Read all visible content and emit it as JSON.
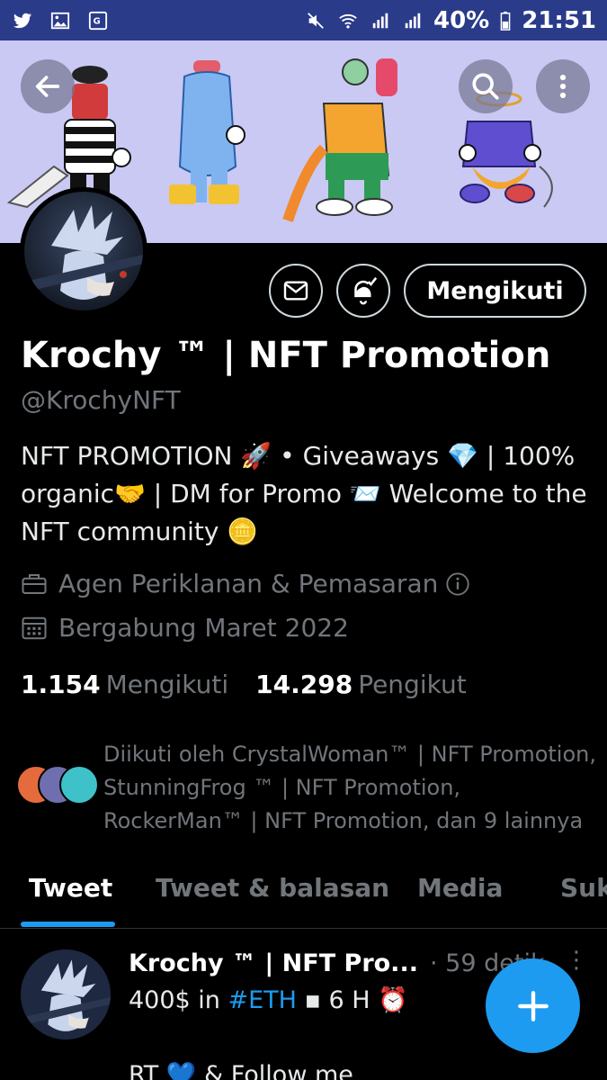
{
  "status_bar": {
    "battery": "40%",
    "time": "21:51",
    "icons": [
      "twitter-icon",
      "gallery-icon",
      "translate-icon",
      "mute-icon",
      "wifi-icon",
      "signal-icon",
      "battery-icon"
    ]
  },
  "header": {
    "back_icon": "arrow-left-icon",
    "search_icon": "search-icon",
    "more_icon": "more-vertical-icon"
  },
  "profile": {
    "follow_label": "Mengikuti",
    "name": "Krochy ™ | NFT Promotion",
    "handle": "@KrochyNFT",
    "bio": "NFT PROMOTION 🚀 • Giveaways 💎 | 100% organic🤝 | DM for Promo 📨 Welcome to the NFT community 🪙",
    "category": "Agen Periklanan & Pemasaran",
    "joined": "Bergabung Maret 2022",
    "following_count": "1.154",
    "following_label": "Mengikuti",
    "followers_count": "14.298",
    "followers_label": "Pengikut",
    "followed_by": "Diikuti oleh CrystalWoman™ | NFT Promotion, StunningFrog ™ | NFT Promotion, RockerMan™ | NFT Promotion, dan 9 lainnya"
  },
  "tabs": [
    {
      "label": "Tweet",
      "active": true
    },
    {
      "label": "Tweet & balasan",
      "active": false
    },
    {
      "label": "Media",
      "active": false
    },
    {
      "label": "Suk",
      "active": false
    }
  ],
  "tweet": {
    "author": "Krochy ™ | NFT Pro...",
    "time": "· 59 detik",
    "text_prefix": "400$ in ",
    "hashtag": "#ETH",
    "text_suffix": " ▪ 6 H ⏰",
    "line2": "RT 💙 & Follow me"
  },
  "colors": {
    "accent": "#1d9bf0",
    "status_bar": "#2a3b8a",
    "banner": "#c9c9f4"
  }
}
